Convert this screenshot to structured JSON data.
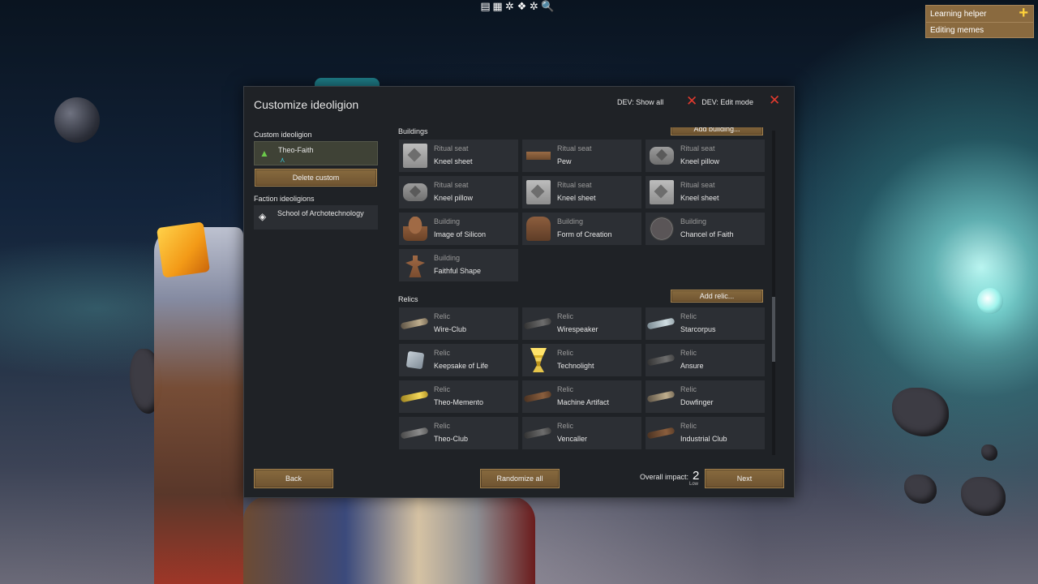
{
  "toolbar": {
    "icons": [
      "list-icon",
      "table-icon",
      "gear-icon",
      "paw-icon",
      "gear-alt-icon",
      "search-icon"
    ],
    "glyphs": [
      "▤",
      "▦",
      "✲",
      "❖",
      "✲",
      "🔍"
    ]
  },
  "learning_helper": {
    "title": "Learning helper",
    "plus": "+",
    "item": "Editing memes"
  },
  "dialog": {
    "title": "Customize ideoligion",
    "dev_show_all": "DEV: Show all",
    "dev_edit_mode": "DEV: Edit mode",
    "close_glyph": "✕",
    "x_glyph": "✕"
  },
  "left": {
    "custom_label": "Custom ideoligion",
    "custom_name": "Theo-Faith",
    "custom_icon": "▲",
    "custom_sub_icon": "⋏",
    "delete_button": "Delete custom",
    "faction_label": "Faction ideoligions",
    "faction_name": "School of Archotechnology",
    "faction_icon": "◈"
  },
  "buildings": {
    "label": "Buildings",
    "add_button": "Add building...",
    "items": [
      {
        "category": "Ritual seat",
        "name": "Kneel sheet",
        "icon": "kneel-sheet-icon"
      },
      {
        "category": "Ritual seat",
        "name": "Pew",
        "icon": "pew-icon"
      },
      {
        "category": "Ritual seat",
        "name": "Kneel pillow",
        "icon": "kneel-pillow-icon"
      },
      {
        "category": "Ritual seat",
        "name": "Kneel pillow",
        "icon": "kneel-pillow-icon"
      },
      {
        "category": "Ritual seat",
        "name": "Kneel sheet",
        "icon": "kneel-sheet-icon"
      },
      {
        "category": "Ritual seat",
        "name": "Kneel sheet",
        "icon": "kneel-sheet-icon"
      },
      {
        "category": "Building",
        "name": "Image of Silicon",
        "icon": "statue-icon"
      },
      {
        "category": "Building",
        "name": "Form of Creation",
        "icon": "altar-icon"
      },
      {
        "category": "Building",
        "name": "Chancel of Faith",
        "icon": "chancel-icon"
      },
      {
        "category": "Building",
        "name": "Faithful Shape",
        "icon": "sculpture-icon"
      }
    ]
  },
  "relics": {
    "label": "Relics",
    "add_button": "Add relic...",
    "items": [
      {
        "category": "Relic",
        "name": "Wire-Club",
        "icon": "club-icon"
      },
      {
        "category": "Relic",
        "name": "Wirespeaker",
        "icon": "club-icon"
      },
      {
        "category": "Relic",
        "name": "Starcorpus",
        "icon": "club-icon"
      },
      {
        "category": "Relic",
        "name": "Keepsake of Life",
        "icon": "cube-icon"
      },
      {
        "category": "Relic",
        "name": "Technolight",
        "icon": "chalice-icon"
      },
      {
        "category": "Relic",
        "name": "Ansure",
        "icon": "club-icon"
      },
      {
        "category": "Relic",
        "name": "Theo-Memento",
        "icon": "club-icon"
      },
      {
        "category": "Relic",
        "name": "Machine Artifact",
        "icon": "club-icon"
      },
      {
        "category": "Relic",
        "name": "Dowfinger",
        "icon": "club-icon"
      },
      {
        "category": "Relic",
        "name": "Theo-Club",
        "icon": "club-icon"
      },
      {
        "category": "Relic",
        "name": "Vencaller",
        "icon": "club-icon"
      },
      {
        "category": "Relic",
        "name": "Industrial Club",
        "icon": "club-icon"
      }
    ]
  },
  "footer": {
    "back_button": "Back",
    "randomize_button": "Randomize all",
    "impact_label": "Overall impact:",
    "impact_value": "2",
    "impact_level": "Low",
    "next_button": "Next"
  },
  "colors": {
    "button": "#7c5f37",
    "dialog_bg": "#1f2226",
    "tile_bg": "#2c2f34",
    "close_red": "#e23a2e"
  }
}
